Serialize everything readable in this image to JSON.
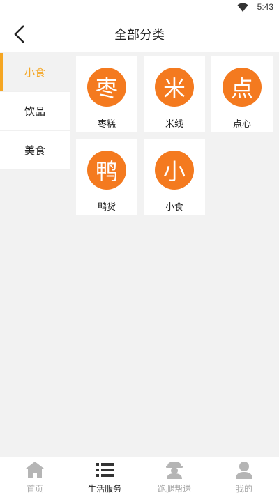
{
  "status_bar": {
    "time": "5:43"
  },
  "header": {
    "title": "全部分类"
  },
  "sidebar": {
    "items": [
      {
        "label": "小食"
      },
      {
        "label": "饮品"
      },
      {
        "label": "美食"
      }
    ]
  },
  "categories": [
    {
      "glyph": "枣",
      "label": "枣糕"
    },
    {
      "glyph": "米",
      "label": "米线"
    },
    {
      "glyph": "点",
      "label": "点心"
    },
    {
      "glyph": "鸭",
      "label": "鸭货"
    },
    {
      "glyph": "小",
      "label": "小食"
    }
  ],
  "tabbar": {
    "items": [
      {
        "label": "首页",
        "icon": "home-icon"
      },
      {
        "label": "生活服务",
        "icon": "list-icon"
      },
      {
        "label": "跑腿帮送",
        "icon": "courier-icon"
      },
      {
        "label": "我的",
        "icon": "user-icon"
      }
    ]
  },
  "colors": {
    "accent": "#f5a623",
    "category_circle": "#f47a1f",
    "tab_inactive": "#aaaaaa"
  }
}
